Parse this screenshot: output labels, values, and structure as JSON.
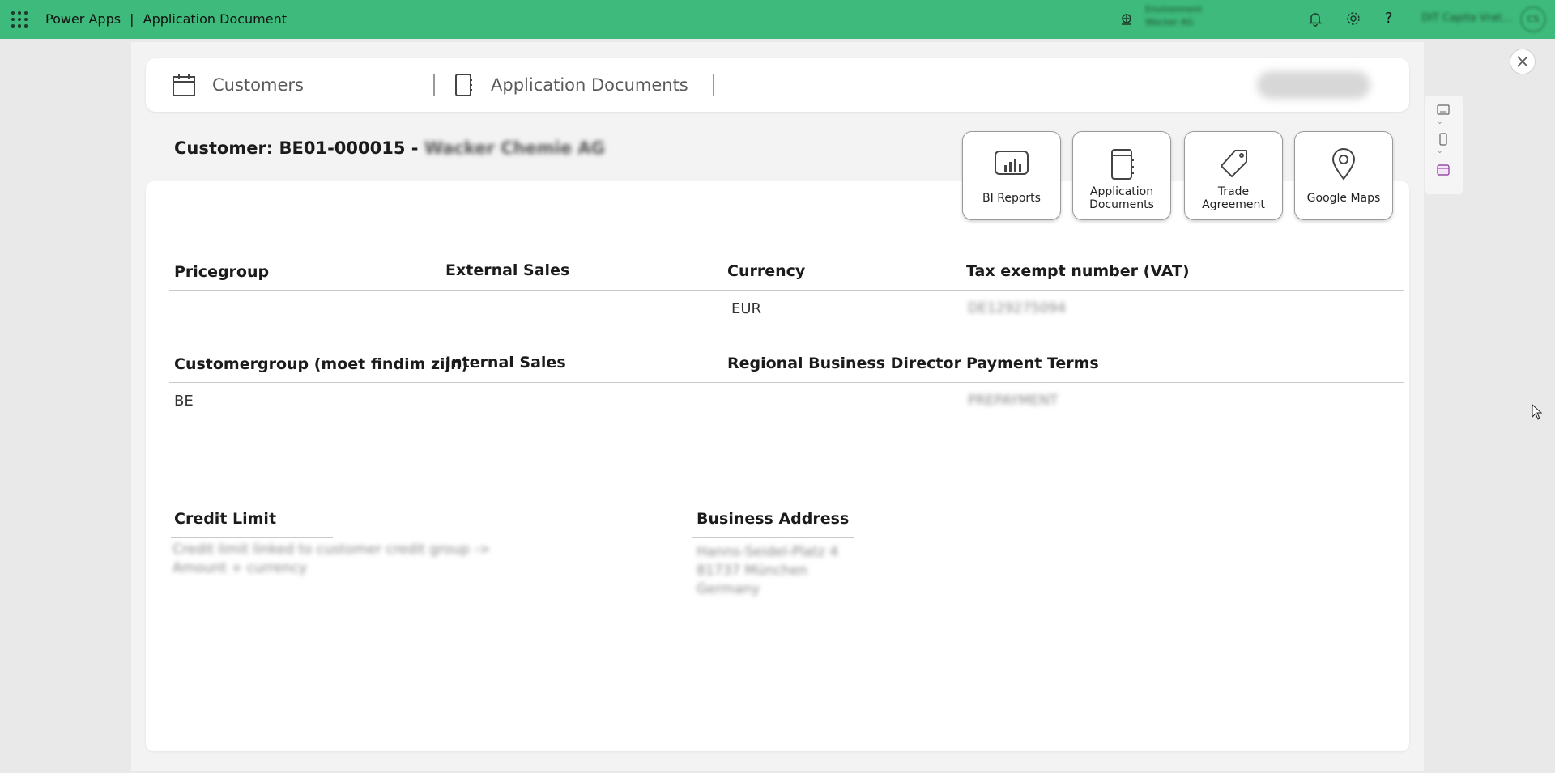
{
  "topbar": {
    "brand": "Power Apps",
    "separator": "|",
    "app_name": "Application Document",
    "environment_line1": "Environment",
    "environment_line2": "Wacker AG",
    "user_name": "DIT Capita Vrat...",
    "avatar_initials": "CS"
  },
  "nav": {
    "tab_customers": "Customers",
    "tab_application_documents": "Application Documents"
  },
  "customer": {
    "prefix": "Customer: BE01-000015 - ",
    "name": "Wacker Chemie AG"
  },
  "actions": {
    "bi_reports": "BI Reports",
    "application_documents": "Application\nDocuments",
    "trade_agreement": "Trade\nAgreement",
    "google_maps": "Google Maps"
  },
  "fields": {
    "pricegroup_label": "Pricegroup",
    "pricegroup_value": "",
    "external_sales_label": "External Sales",
    "external_sales_value": "",
    "currency_label": "Currency",
    "currency_value": "EUR",
    "vat_label": "Tax exempt number (VAT)",
    "vat_value": "DE129275094",
    "customergroup_label": "Customergroup (moet findim zijn)",
    "customergroup_value": "BE",
    "internal_sales_label": "Internal Sales",
    "internal_sales_value": "",
    "rbd_label": "Regional Business Director",
    "rbd_value": "",
    "payment_terms_label": "Payment Terms",
    "payment_terms_value": "PREPAYMENT",
    "credit_limit_label": "Credit Limit",
    "credit_limit_value": "Credit limit linked to customer credit group ->\nAmount + currency",
    "business_address_label": "Business Address",
    "business_address_value": "Hanns-Seidel-Platz 4\n81737 München\nGermany"
  }
}
